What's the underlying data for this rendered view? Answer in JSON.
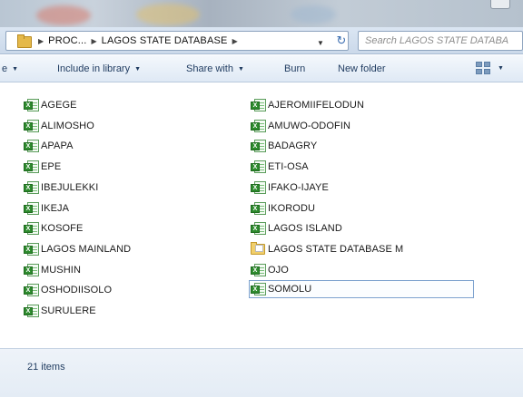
{
  "address": {
    "crumbs": [
      "PROC...",
      "LAGOS STATE DATABASE"
    ],
    "search_placeholder": "Search LAGOS STATE DATABA"
  },
  "toolbar": {
    "organize_caret": "e",
    "include_label": "Include in library",
    "share_label": "Share with",
    "burn_label": "Burn",
    "new_folder_label": "New folder"
  },
  "files": {
    "column1": [
      {
        "name": "AGEGE",
        "icon": "excel-file-icon"
      },
      {
        "name": "ALIMOSHO",
        "icon": "excel-file-icon"
      },
      {
        "name": "APAPA",
        "icon": "excel-file-icon"
      },
      {
        "name": "EPE",
        "icon": "excel-file-icon"
      },
      {
        "name": "IBEJULEKKI",
        "icon": "excel-file-icon"
      },
      {
        "name": "IKEJA",
        "icon": "excel-file-icon"
      },
      {
        "name": "KOSOFE",
        "icon": "excel-file-icon"
      },
      {
        "name": "LAGOS MAINLAND",
        "icon": "excel-file-icon"
      },
      {
        "name": "MUSHIN",
        "icon": "excel-file-icon"
      },
      {
        "name": "OSHODIISOLO",
        "icon": "excel-file-icon"
      },
      {
        "name": "SURULERE",
        "icon": "excel-file-icon"
      }
    ],
    "column2": [
      {
        "name": "AJEROMIIFELODUN",
        "icon": "excel-file-icon"
      },
      {
        "name": "AMUWO-ODOFIN",
        "icon": "excel-file-icon"
      },
      {
        "name": "BADAGRY",
        "icon": "excel-file-icon"
      },
      {
        "name": "ETI-OSA",
        "icon": "excel-file-icon"
      },
      {
        "name": "IFAKO-IJAYE",
        "icon": "excel-file-icon"
      },
      {
        "name": "IKORODU",
        "icon": "excel-file-icon"
      },
      {
        "name": "LAGOS ISLAND",
        "icon": "excel-file-icon"
      },
      {
        "name": "LAGOS STATE DATABASE M",
        "icon": "folder-icon"
      },
      {
        "name": "OJO",
        "icon": "excel-file-icon"
      },
      {
        "name": "SOMOLU",
        "icon": "excel-file-icon",
        "selected": true
      }
    ]
  },
  "status": {
    "item_count": "21 items"
  },
  "colors": {
    "accent": "#1e3a5f",
    "selection_border": "#7da2ce",
    "excel_green": "#2e8b2e",
    "folder_yellow": "#f1cf6b"
  }
}
